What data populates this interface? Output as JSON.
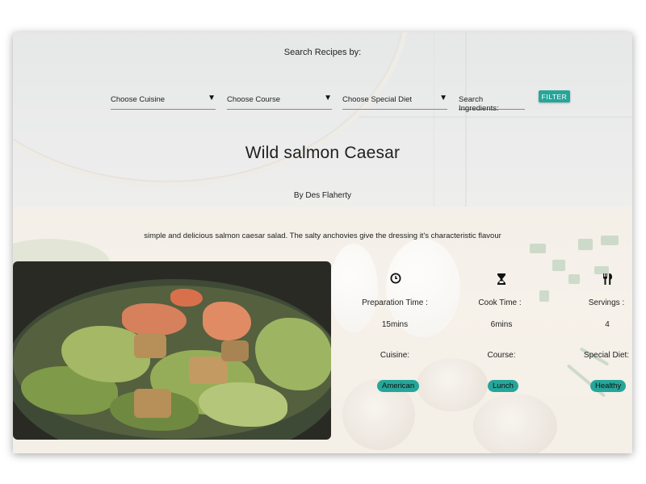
{
  "search": {
    "heading": "Search Recipes by:",
    "cuisine_placeholder": "Choose Cuisine",
    "course_placeholder": "Choose Course",
    "diet_placeholder": "Choose Special Diet",
    "ingredients_placeholder": "Search Ingredients:",
    "filter_label": "FILTER",
    "dropdown_arrow": "▼"
  },
  "recipe": {
    "title": "Wild salmon Caesar",
    "author": "By Des Flaherty",
    "description": "simple and delicious salmon caesar salad. The salty anchovies give the dressing it's characteristic flavour",
    "prep_label": "Preparation Time :",
    "prep_value": "15mins",
    "cook_label": "Cook Time :",
    "cook_value": "6mins",
    "servings_label": "Servings :",
    "servings_value": "4",
    "cuisine_label": "Cuisine:",
    "cuisine_value": "American",
    "course_label": "Course:",
    "course_value": "Lunch",
    "diet_label": "Special Diet:",
    "diet_value": "Healthy"
  },
  "icons": {
    "clock": "clock-icon",
    "hourglass": "hourglass-icon",
    "cutlery": "cutlery-icon"
  },
  "colors": {
    "accent": "#26a69a"
  }
}
